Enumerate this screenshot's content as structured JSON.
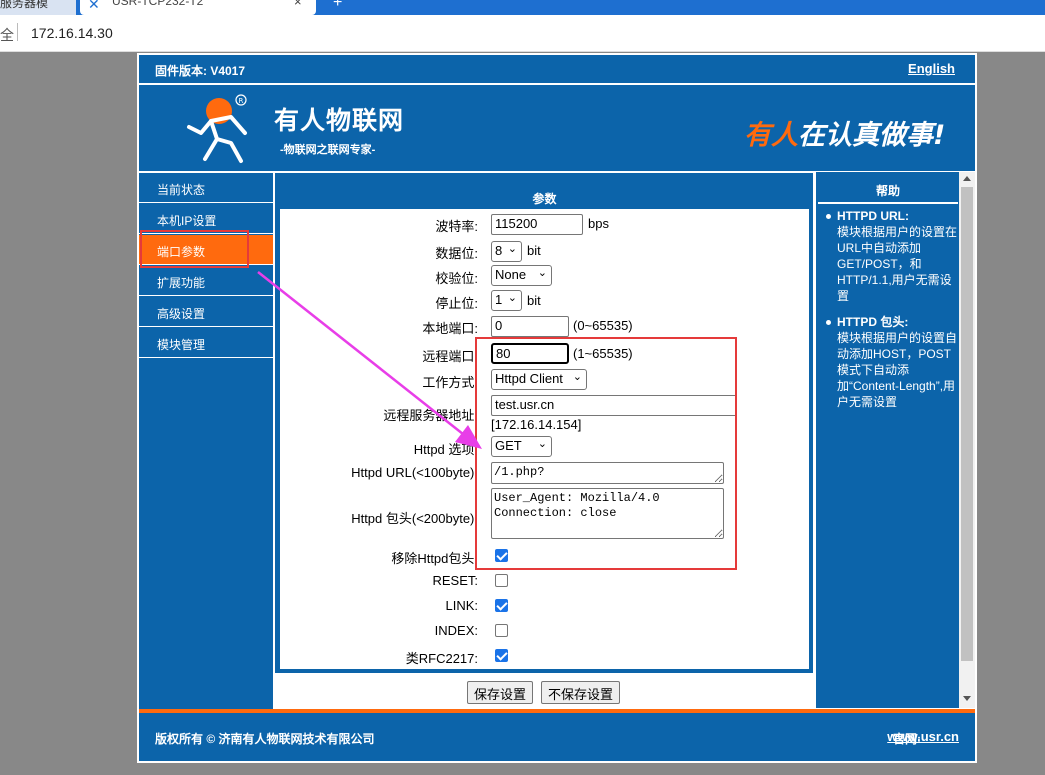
{
  "browser": {
    "tab1_title": "服务器模",
    "tab2_title": "USR-TCP232-T2",
    "tab2_close": "×",
    "new_tab": "+",
    "security_label": "全",
    "url": "172.16.14.30"
  },
  "header": {
    "firmware_label": "固件版本: V4017",
    "language_link": "English"
  },
  "banner": {
    "brand_name": "有人物联网",
    "brand_sub": "-物联网之联网专家-",
    "slogan_part1": "有人",
    "slogan_part2": "在认真做事!",
    "registered_mark": "R"
  },
  "sidebar": {
    "items": [
      {
        "label": "当前状态"
      },
      {
        "label": "本机IP设置"
      },
      {
        "label": "端口参数"
      },
      {
        "label": "扩展功能"
      },
      {
        "label": "高级设置"
      },
      {
        "label": "模块管理"
      }
    ]
  },
  "panel": {
    "title": "参数",
    "baud": {
      "label": "波特率:",
      "value": "115200",
      "unit": "bps"
    },
    "data_bits": {
      "label": "数据位:",
      "value": "8",
      "unit": "bit"
    },
    "parity": {
      "label": "校验位:",
      "value": "None"
    },
    "stop_bits": {
      "label": "停止位:",
      "value": "1",
      "unit": "bit"
    },
    "local_port": {
      "label": "本地端口:",
      "value": "0",
      "range": "(0~65535)"
    },
    "remote_port": {
      "label": "远程端口:",
      "value": "80",
      "range": "(1~65535)"
    },
    "work_mode": {
      "label": "工作方式:",
      "value": "Httpd Client"
    },
    "remote_server": {
      "label": "远程服务器地址:",
      "value": "test.usr.cn",
      "resolved": "[172.16.14.154]"
    },
    "httpd_option": {
      "label": "Httpd 选项:",
      "value": "GET"
    },
    "httpd_url": {
      "label": "Httpd URL(<100byte):",
      "value": "/1.php?"
    },
    "httpd_header": {
      "label": "Httpd 包头(<200byte):",
      "value": "User_Agent: Mozilla/4.0\nConnection: close"
    },
    "remove_header": {
      "label": "移除Httpd包头:",
      "checked": true
    },
    "reset": {
      "label": "RESET:",
      "checked": false
    },
    "link": {
      "label": "LINK:",
      "checked": true
    },
    "index": {
      "label": "INDEX:",
      "checked": false
    },
    "rfc2217": {
      "label": "类RFC2217:",
      "checked": true
    },
    "save_button": "保存设置",
    "nosave_button": "不保存设置"
  },
  "help": {
    "title": "帮助",
    "items": [
      {
        "title": "HTTPD URL:",
        "text": "模块根据用户的设置在URL中自动添加GET/POST，和HTTP/1.1,用户无需设置"
      },
      {
        "title": "HTTPD 包头:",
        "text": "模块根据用户的设置自动添加HOST，POST模式下自动添加“Content-Length”,用户无需设置"
      }
    ]
  },
  "footer": {
    "copyright": "版权所有 © 济南有人物联网技术有限公司",
    "site_label": "官网:",
    "site_link": "www.usr.cn"
  },
  "colors": {
    "brand_blue": "#0c64aa",
    "accent_orange": "#ff6a0e",
    "annotation_red": "#e53a3a",
    "annotation_arrow": "#e83ee8"
  }
}
